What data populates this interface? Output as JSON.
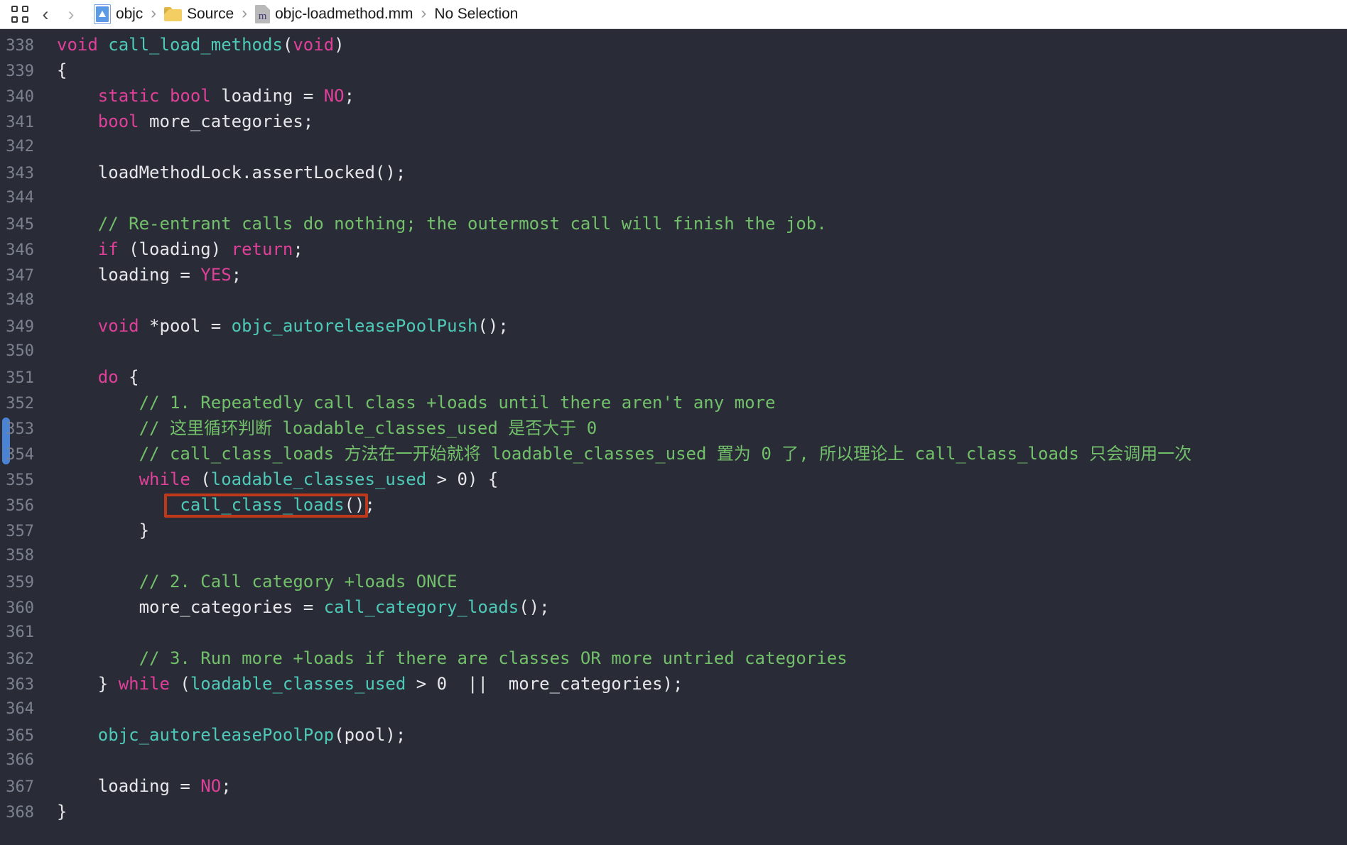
{
  "window": {
    "title": "objc-loadmethod.mm",
    "background": "#292c36",
    "chrome_background": "#ffffff"
  },
  "jump_bar": {
    "layout_button": "editor-layout",
    "back_label": "‹",
    "forward_label": "›",
    "separator": "›",
    "breadcrumbs": [
      {
        "label": "objc",
        "icon": "xcode-project-icon"
      },
      {
        "label": "Source",
        "icon": "folder-icon"
      },
      {
        "label": "objc-loadmethod.mm",
        "icon": "objc-source-file-icon"
      },
      {
        "label": "No Selection",
        "icon": "none"
      }
    ],
    "file_icon_glyph": "m"
  },
  "editor": {
    "first_line_number": 338,
    "language": "objective-c++",
    "colors": {
      "background": "#292c36",
      "line_number": "#7c818f",
      "plain": "#e6e7ea",
      "keyword": "#e0409a",
      "function": "#4ec9b8",
      "comment": "#72c06a",
      "change_bar": "#4a83d4",
      "annotation": "#c0381a"
    },
    "change_bar": {
      "from_line": 353,
      "to_line": 354
    },
    "annotation_box": {
      "line": 356,
      "text": "call_class_loads();"
    },
    "lines": [
      {
        "n": 338,
        "tokens": [
          {
            "t": "void",
            "c": "kw"
          },
          {
            "t": " ",
            "c": "pln"
          },
          {
            "t": "call_load_methods",
            "c": "fn"
          },
          {
            "t": "(",
            "c": "pln"
          },
          {
            "t": "void",
            "c": "kw"
          },
          {
            "t": ")",
            "c": "pln"
          }
        ]
      },
      {
        "n": 339,
        "tokens": [
          {
            "t": "{",
            "c": "pln"
          }
        ]
      },
      {
        "n": 340,
        "tokens": [
          {
            "t": "    ",
            "c": "pln"
          },
          {
            "t": "static",
            "c": "kw"
          },
          {
            "t": " ",
            "c": "pln"
          },
          {
            "t": "bool",
            "c": "kw"
          },
          {
            "t": " loading = ",
            "c": "pln"
          },
          {
            "t": "NO",
            "c": "kw"
          },
          {
            "t": ";",
            "c": "pln"
          }
        ]
      },
      {
        "n": 341,
        "tokens": [
          {
            "t": "    ",
            "c": "pln"
          },
          {
            "t": "bool",
            "c": "kw"
          },
          {
            "t": " more_categories;",
            "c": "pln"
          }
        ]
      },
      {
        "n": 342,
        "tokens": []
      },
      {
        "n": 343,
        "tokens": [
          {
            "t": "    loadMethodLock.assertLocked();",
            "c": "pln"
          }
        ]
      },
      {
        "n": 344,
        "tokens": []
      },
      {
        "n": 345,
        "tokens": [
          {
            "t": "    ",
            "c": "pln"
          },
          {
            "t": "// Re-entrant calls do nothing; the outermost call will finish the job.",
            "c": "cmt"
          }
        ]
      },
      {
        "n": 346,
        "tokens": [
          {
            "t": "    ",
            "c": "pln"
          },
          {
            "t": "if",
            "c": "kw"
          },
          {
            "t": " (loading) ",
            "c": "pln"
          },
          {
            "t": "return",
            "c": "kw"
          },
          {
            "t": ";",
            "c": "pln"
          }
        ]
      },
      {
        "n": 347,
        "tokens": [
          {
            "t": "    loading = ",
            "c": "pln"
          },
          {
            "t": "YES",
            "c": "kw"
          },
          {
            "t": ";",
            "c": "pln"
          }
        ]
      },
      {
        "n": 348,
        "tokens": []
      },
      {
        "n": 349,
        "tokens": [
          {
            "t": "    ",
            "c": "pln"
          },
          {
            "t": "void",
            "c": "kw"
          },
          {
            "t": " *pool = ",
            "c": "pln"
          },
          {
            "t": "objc_autoreleasePoolPush",
            "c": "fn"
          },
          {
            "t": "();",
            "c": "pln"
          }
        ]
      },
      {
        "n": 350,
        "tokens": []
      },
      {
        "n": 351,
        "tokens": [
          {
            "t": "    ",
            "c": "pln"
          },
          {
            "t": "do",
            "c": "kw"
          },
          {
            "t": " {",
            "c": "pln"
          }
        ]
      },
      {
        "n": 352,
        "tokens": [
          {
            "t": "        ",
            "c": "pln"
          },
          {
            "t": "// 1. Repeatedly call class +loads until there aren't any more",
            "c": "cmt"
          }
        ]
      },
      {
        "n": 353,
        "tokens": [
          {
            "t": "        ",
            "c": "pln"
          },
          {
            "t": "// 这里循环判断 loadable_classes_used 是否大于 0",
            "c": "cmt"
          }
        ]
      },
      {
        "n": 354,
        "tokens": [
          {
            "t": "        ",
            "c": "pln"
          },
          {
            "t": "// call_class_loads 方法在一开始就将 loadable_classes_used 置为 0 了, 所以理论上 call_class_loads 只会调用一次",
            "c": "cmt"
          }
        ]
      },
      {
        "n": 355,
        "tokens": [
          {
            "t": "        ",
            "c": "pln"
          },
          {
            "t": "while",
            "c": "kw"
          },
          {
            "t": " (",
            "c": "pln"
          },
          {
            "t": "loadable_classes_used",
            "c": "var"
          },
          {
            "t": " > ",
            "c": "pln"
          },
          {
            "t": "0",
            "c": "num"
          },
          {
            "t": ") {",
            "c": "pln"
          }
        ]
      },
      {
        "n": 356,
        "tokens": [
          {
            "t": "            ",
            "c": "pln"
          },
          {
            "t": "call_class_loads",
            "c": "fn"
          },
          {
            "t": "();",
            "c": "pln"
          }
        ]
      },
      {
        "n": 357,
        "tokens": [
          {
            "t": "        }",
            "c": "pln"
          }
        ]
      },
      {
        "n": 358,
        "tokens": []
      },
      {
        "n": 359,
        "tokens": [
          {
            "t": "        ",
            "c": "pln"
          },
          {
            "t": "// 2. Call category +loads ONCE",
            "c": "cmt"
          }
        ]
      },
      {
        "n": 360,
        "tokens": [
          {
            "t": "        more_categories = ",
            "c": "pln"
          },
          {
            "t": "call_category_loads",
            "c": "fn"
          },
          {
            "t": "();",
            "c": "pln"
          }
        ]
      },
      {
        "n": 361,
        "tokens": []
      },
      {
        "n": 362,
        "tokens": [
          {
            "t": "        ",
            "c": "pln"
          },
          {
            "t": "// 3. Run more +loads if there are classes OR more untried categories",
            "c": "cmt"
          }
        ]
      },
      {
        "n": 363,
        "tokens": [
          {
            "t": "    } ",
            "c": "pln"
          },
          {
            "t": "while",
            "c": "kw"
          },
          {
            "t": " (",
            "c": "pln"
          },
          {
            "t": "loadable_classes_used",
            "c": "var"
          },
          {
            "t": " > ",
            "c": "pln"
          },
          {
            "t": "0",
            "c": "num"
          },
          {
            "t": "  ||  more_categories);",
            "c": "pln"
          }
        ]
      },
      {
        "n": 364,
        "tokens": []
      },
      {
        "n": 365,
        "tokens": [
          {
            "t": "    ",
            "c": "pln"
          },
          {
            "t": "objc_autoreleasePoolPop",
            "c": "fn"
          },
          {
            "t": "(pool);",
            "c": "pln"
          }
        ]
      },
      {
        "n": 366,
        "tokens": []
      },
      {
        "n": 367,
        "tokens": [
          {
            "t": "    loading = ",
            "c": "pln"
          },
          {
            "t": "NO",
            "c": "kw"
          },
          {
            "t": ";",
            "c": "pln"
          }
        ]
      },
      {
        "n": 368,
        "tokens": [
          {
            "t": "}",
            "c": "pln"
          }
        ]
      }
    ]
  }
}
